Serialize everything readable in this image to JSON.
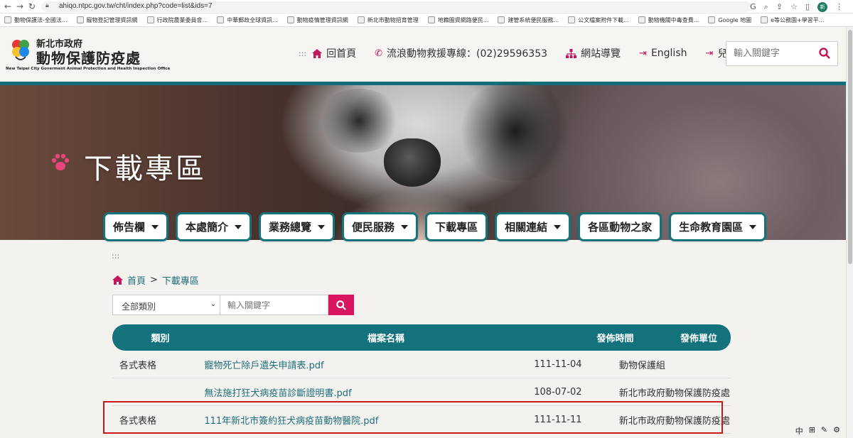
{
  "browser": {
    "url": "ahiqo.ntpc.gov.tw/cht/index.php?code=list&ids=7",
    "profile_initial": "新",
    "bookmarks": [
      "動物保護法-全國法...",
      "寵物登記管理資訊網",
      "行政院農業委員會...",
      "中華郵政全球資訊...",
      "動物疫情管理資訊網",
      "新北市動物招育管理",
      "地籍圖資網路便民...",
      "建管系統便民服務...",
      "公文檔案附件下載...",
      "動物機關中毒查費...",
      "Google 地圖",
      "e等公務園+學習平..."
    ]
  },
  "header": {
    "logo_small": "新北市政府",
    "logo_big": "動物保護防疫處",
    "logo_english": "New Taipei City Goverment Animal Protection and Health Inspection Office",
    "accesskey": ":::",
    "links": {
      "home": "回首頁",
      "hotline": "流浪動物救援專線：(02)29596353",
      "sitemap": "網站導覽",
      "english": "English",
      "kids": "兒童網"
    },
    "search_placeholder": "輸入關鍵字"
  },
  "banner": {
    "title": "下載專區"
  },
  "nav": [
    {
      "label": "佈告欄",
      "dropdown": true
    },
    {
      "label": "本處簡介",
      "dropdown": true
    },
    {
      "label": "業務總覽",
      "dropdown": true
    },
    {
      "label": "便民服務",
      "dropdown": true
    },
    {
      "label": "下載專區",
      "dropdown": false
    },
    {
      "label": "相關連結",
      "dropdown": true
    },
    {
      "label": "各區動物之家",
      "dropdown": false
    },
    {
      "label": "生命教育園區",
      "dropdown": true
    }
  ],
  "content": {
    "accesskey": ":::",
    "breadcrumb": {
      "home": "首頁",
      "separator": ">",
      "current": "下載專區"
    },
    "filter": {
      "category_selected": "全部類別",
      "keyword_placeholder": "輸入關鍵字"
    },
    "table": {
      "headers": [
        "類別",
        "檔案名稱",
        "發佈時間",
        "發佈單位"
      ],
      "rows": [
        {
          "type": "各式表格",
          "name": "寵物死亡除戶遺失申請表.pdf",
          "date": "111-11-04",
          "unit": "動物保護組"
        },
        {
          "type": "",
          "name": "無法施打狂犬病疫苗診斷證明書.pdf",
          "date": "108-07-02",
          "unit": "新北市政府動物保護防疫處"
        },
        {
          "type": "各式表格",
          "name": "111年新北市簽約狂犬病疫苗動物醫院.pdf",
          "date": "111-11-11",
          "unit": "新北市政府動物保護防疫處"
        }
      ]
    }
  },
  "taskbar_fragment": [
    "中",
    "⊞",
    "✎",
    "⚙"
  ],
  "colors": {
    "teal": "#13727c",
    "magenta": "#d8155f",
    "highlight_red": "#c8191d",
    "link": "#1f6f78"
  }
}
